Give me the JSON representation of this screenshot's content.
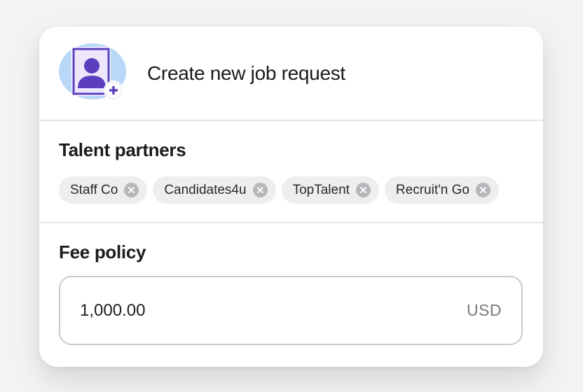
{
  "header": {
    "title": "Create new job request",
    "icon": "user-add-icon"
  },
  "talent_partners": {
    "heading": "Talent partners",
    "chips": [
      {
        "label": "Staff Co"
      },
      {
        "label": "Candidates4u"
      },
      {
        "label": "TopTalent"
      },
      {
        "label": "Recruit'n Go"
      }
    ]
  },
  "fee_policy": {
    "heading": "Fee policy",
    "amount": "1,000.00",
    "currency": "USD"
  },
  "colors": {
    "accent": "#5b3fbf",
    "avatar_bg": "#b9d7f7",
    "chip_bg": "#eeeeef"
  }
}
